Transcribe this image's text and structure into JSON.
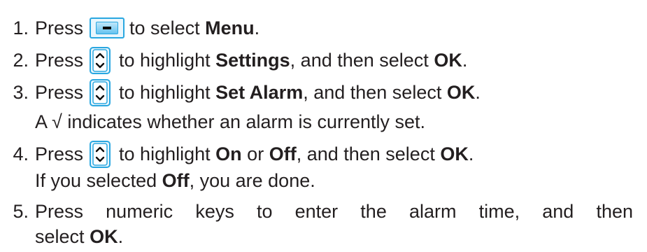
{
  "steps": [
    {
      "number": "1.",
      "press": "Press",
      "icon": "menu-softkey-icon",
      "after_icon": "to select",
      "bold": "Menu",
      "end": "."
    },
    {
      "number": "2.",
      "press": "Press",
      "icon": "up-down-navigation-icon",
      "after_icon": "to highlight",
      "bold": "Settings",
      "middle": ", and then select",
      "bold2": "OK",
      "end": "."
    },
    {
      "number": "3.",
      "press": "Press",
      "icon": "up-down-navigation-icon",
      "after_icon": "to highlight",
      "bold": "Set Alarm",
      "middle": ", and then select",
      "bold2": "OK",
      "end": ".",
      "note": "A √ indicates whether an alarm is currently set."
    },
    {
      "number": "4.",
      "press": "Press",
      "icon": "up-down-navigation-icon",
      "after_icon": "to highlight",
      "bold": "On",
      "or": "or",
      "bold_alt": "Off",
      "middle": ", and then select",
      "bold2": "OK",
      "end": ".",
      "note_prefix": "If you selected",
      "note_bold": "Off",
      "note_suffix": ", you are done."
    },
    {
      "number": "5.",
      "words": [
        "Press",
        "numeric",
        "keys",
        "to",
        "enter",
        "the",
        "alarm",
        "time,",
        "and",
        "then"
      ],
      "line2_prefix": "select",
      "line2_bold": "OK",
      "line2_end": "."
    }
  ],
  "colors": {
    "text": "#231f20",
    "icon_accent": "#2aa7e0"
  }
}
